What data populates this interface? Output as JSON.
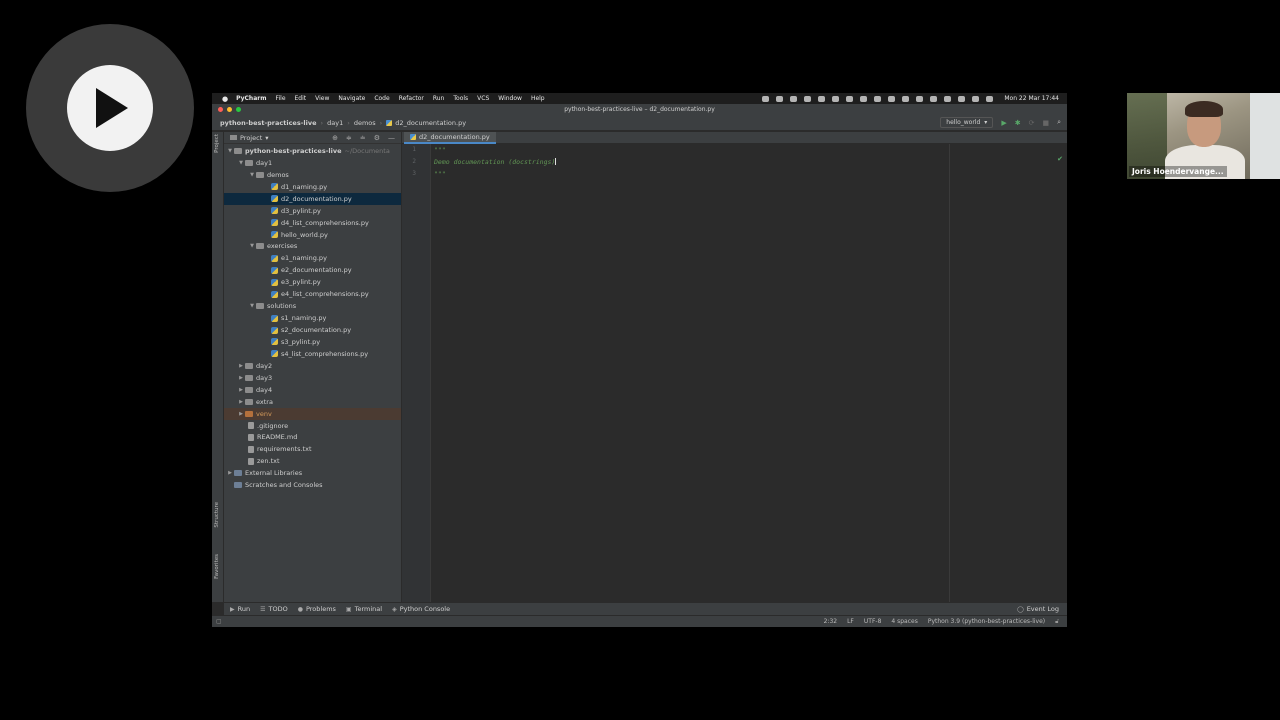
{
  "webcam": {
    "name": "Joris Hoendervange..."
  },
  "menubar": {
    "apple": "",
    "app_name": "PyCharm",
    "items": [
      "File",
      "Edit",
      "View",
      "Navigate",
      "Code",
      "Refactor",
      "Run",
      "Tools",
      "VCS",
      "Window",
      "Help"
    ],
    "clock": "Mon 22 Mar  17:44"
  },
  "window": {
    "title": "python-best-practices-live – d2_documentation.py"
  },
  "navbar": {
    "crumbs": [
      "python-best-practices-live",
      "day1",
      "demos",
      "d2_documentation.py"
    ],
    "run_config": "hello_world"
  },
  "side_tabs": {
    "project": "Project",
    "structure": "Structure",
    "favorites": "Favorites"
  },
  "project_panel": {
    "title": "Project"
  },
  "tree": {
    "root": "python-best-practices-live",
    "root_path": "~/Documenta",
    "day1": "day1",
    "demos": "demos",
    "demos_files": [
      "d1_naming.py",
      "d2_documentation.py",
      "d3_pylint.py",
      "d4_list_comprehensions.py",
      "hello_world.py"
    ],
    "exercises": "exercises",
    "exercises_files": [
      "e1_naming.py",
      "e2_documentation.py",
      "e3_pylint.py",
      "e4_list_comprehensions.py"
    ],
    "solutions": "solutions",
    "solutions_files": [
      "s1_naming.py",
      "s2_documentation.py",
      "s3_pylint.py",
      "s4_list_comprehensions.py"
    ],
    "folders": [
      "day2",
      "day3",
      "day4",
      "extra"
    ],
    "venv": "venv",
    "root_files": [
      ".gitignore",
      "README.md",
      "requirements.txt",
      "zen.txt"
    ],
    "external": "External Libraries",
    "scratches": "Scratches and Consoles"
  },
  "editor": {
    "tab": "d2_documentation.py",
    "line_numbers": [
      "1",
      "2",
      "3"
    ],
    "lines": [
      "\"\"\"",
      "Demo documentation (docstrings)",
      "\"\"\""
    ]
  },
  "bottom_tools": {
    "items": [
      "Run",
      "TODO",
      "Problems",
      "Terminal",
      "Python Console"
    ],
    "event_log": "Event Log"
  },
  "statusbar": {
    "position": "2:32",
    "line_sep": "LF",
    "encoding": "UTF-8",
    "indent": "4 spaces",
    "interpreter": "Python 3.9 (python-best-practices-live)"
  }
}
